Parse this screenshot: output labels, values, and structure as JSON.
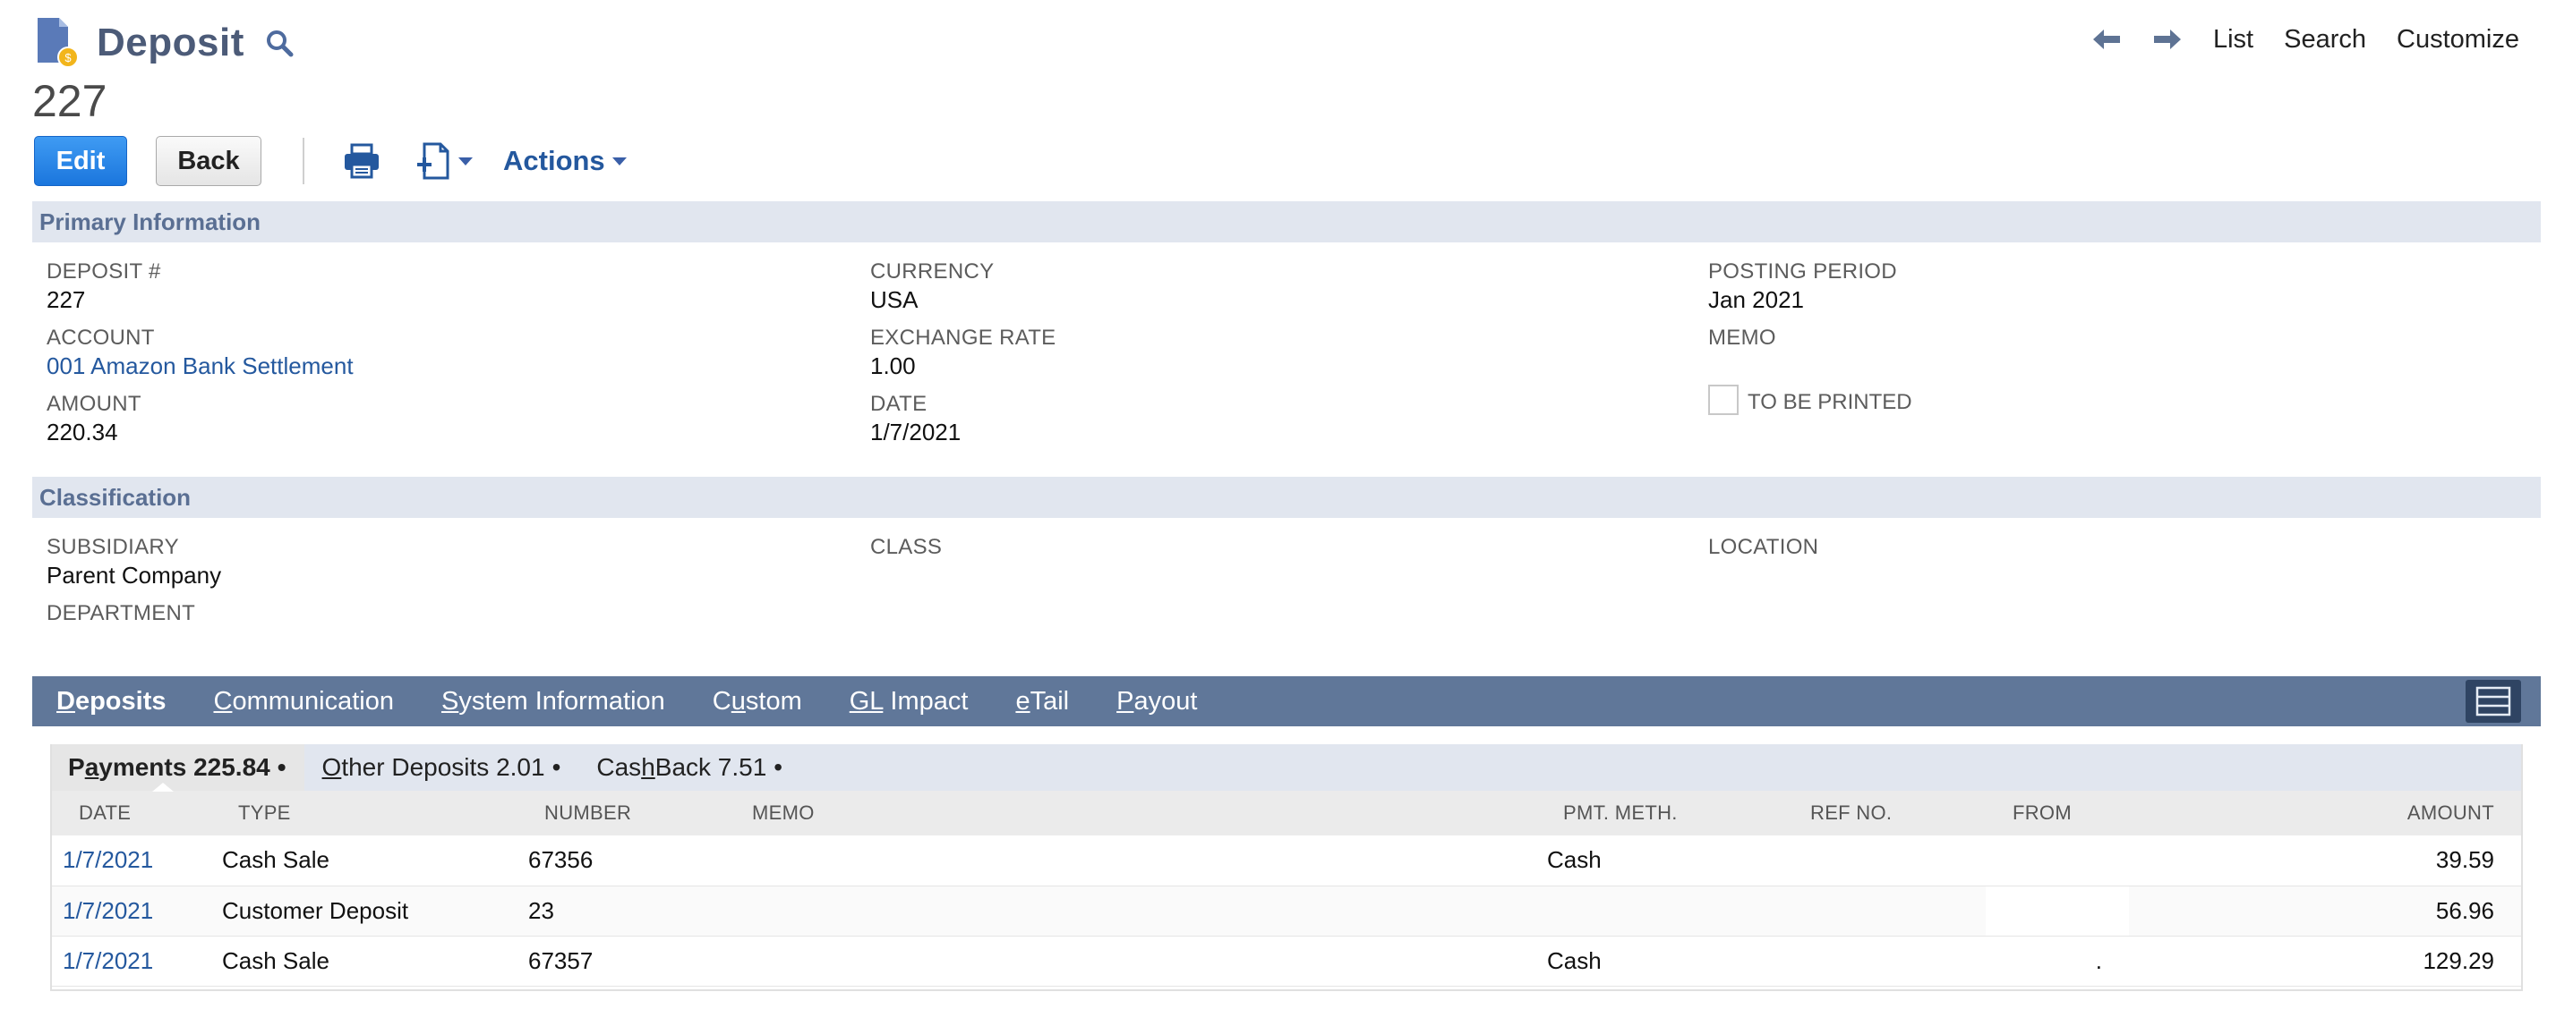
{
  "header": {
    "title": "Deposit",
    "record_number": "227",
    "nav": {
      "list": "List",
      "search": "Search",
      "customize": "Customize"
    }
  },
  "toolbar": {
    "edit_label": "Edit",
    "back_label": "Back",
    "actions_label": "Actions"
  },
  "primary": {
    "section_title": "Primary Information",
    "deposit_no": {
      "label": "DEPOSIT #",
      "value": "227"
    },
    "currency": {
      "label": "CURRENCY",
      "value": "USA"
    },
    "posting_period": {
      "label": "POSTING PERIOD",
      "value": "Jan 2021"
    },
    "account": {
      "label": "ACCOUNT",
      "value": "001 Amazon Bank Settlement"
    },
    "exchange_rate": {
      "label": "EXCHANGE RATE",
      "value": "1.00"
    },
    "memo": {
      "label": "MEMO",
      "value": ""
    },
    "amount": {
      "label": "AMOUNT",
      "value": "220.34"
    },
    "date": {
      "label": "DATE",
      "value": "1/7/2021"
    },
    "to_be_printed": {
      "label": "TO BE PRINTED",
      "checked": false
    }
  },
  "classification": {
    "section_title": "Classification",
    "subsidiary": {
      "label": "SUBSIDIARY",
      "value": "Parent Company"
    },
    "class": {
      "label": "CLASS",
      "value": ""
    },
    "location": {
      "label": "LOCATION",
      "value": ""
    },
    "department": {
      "label": "DEPARTMENT",
      "value": ""
    }
  },
  "subtabs": [
    {
      "first": "D",
      "rest": "eposits",
      "active": true
    },
    {
      "first": "C",
      "rest": "ommunication",
      "active": false
    },
    {
      "first": "S",
      "rest": "ystem Information",
      "active": false
    },
    {
      "pre": "C",
      "first": "u",
      "rest": "stom",
      "active": false
    },
    {
      "first": "GL",
      "rest": " Impact",
      "active": false
    },
    {
      "first": "e",
      "rest": "Tail",
      "active": false
    },
    {
      "first": "P",
      "rest": "ayout",
      "active": false
    }
  ],
  "sublist_tabs": [
    {
      "pre": "P",
      "u": "a",
      "rest": "yments 225.84",
      "active": true
    },
    {
      "pre": "",
      "u": "O",
      "rest": "ther Deposits 2.01",
      "active": false
    },
    {
      "pre": "Cas",
      "u": "h",
      "rest": " Back 7.51",
      "active": false
    }
  ],
  "bullet": "•",
  "payments": {
    "columns": [
      "DATE",
      "TYPE",
      "NUMBER",
      "MEMO",
      "PMT. METH.",
      "REF NO.",
      "FROM",
      "AMOUNT"
    ],
    "rows": [
      {
        "date": "1/7/2021",
        "type": "Cash Sale",
        "number": "67356",
        "memo": "",
        "pmt": "Cash",
        "ref": "",
        "from": "",
        "amount": "39.59"
      },
      {
        "date": "1/7/2021",
        "type": "Customer Deposit",
        "number": "23",
        "memo": "",
        "pmt": "",
        "ref": "",
        "from": "",
        "amount": "56.96"
      },
      {
        "date": "1/7/2021",
        "type": "Cash Sale",
        "number": "67357",
        "memo": "",
        "pmt": "Cash",
        "ref": "",
        "from": ".",
        "amount": "129.29"
      }
    ]
  },
  "colors": {
    "accent": "#1b76dd",
    "link": "#24589e",
    "tab_bar": "#607799",
    "section_bg": "#e1e6ef"
  }
}
